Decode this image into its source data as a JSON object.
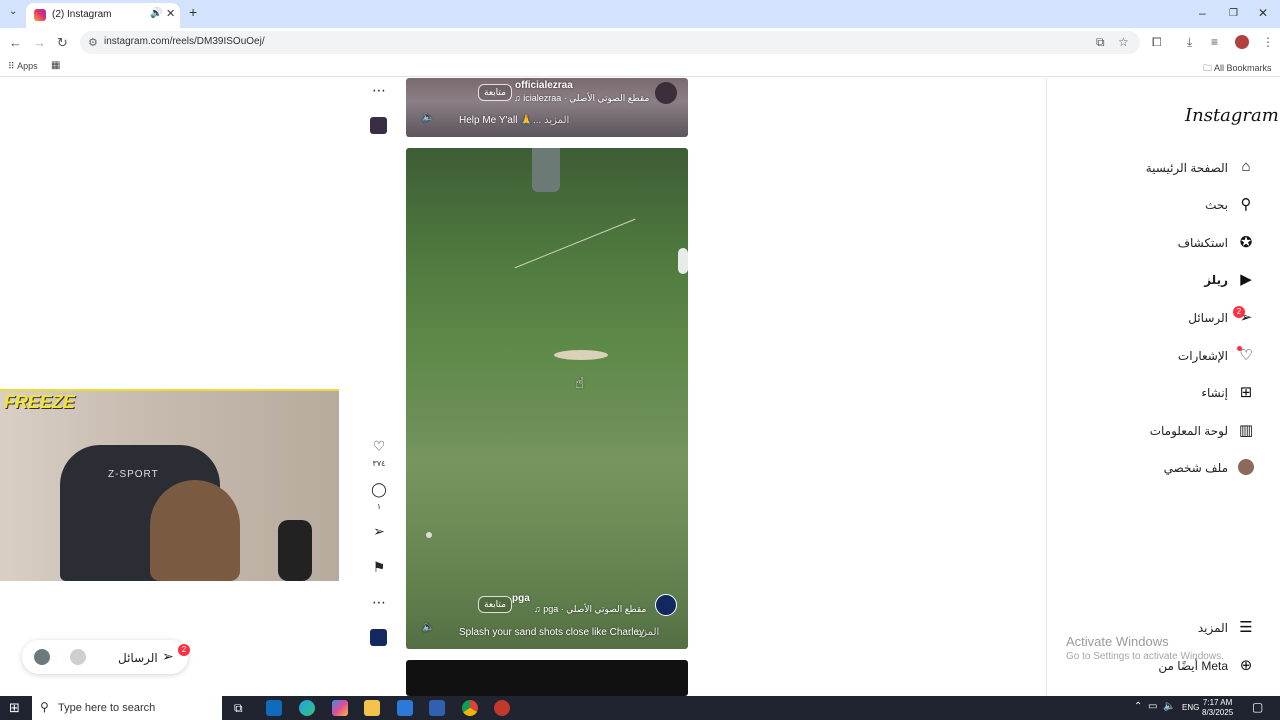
{
  "browser": {
    "tab_title": "(2) Instagram",
    "url": "instagram.com/reels/DM39ISOuOej/",
    "bookmarks": {
      "apps_label": "Apps",
      "all_bookmarks_label": "All Bookmarks"
    }
  },
  "reels": [
    {
      "username": "officialezraa",
      "follow_label": "متابعة",
      "audio": "icialezraa · مقطع الصوتي الأصلي",
      "caption": "Help Me Y'all 🙏",
      "more_label": "... المزيد"
    },
    {
      "username": "pga",
      "follow_label": "متابعة",
      "audio": "pga · مقطع الصوتي الأصلي",
      "caption": "Splash your sand shots close like Charley",
      "more_label": "... المزيد",
      "likes": "٣٧٤",
      "comments": "١"
    }
  ],
  "sidebar": {
    "logo": "Instagram",
    "items": [
      {
        "label": "الصفحة الرئيسية",
        "icon": "home-icon"
      },
      {
        "label": "بحث",
        "icon": "search-icon"
      },
      {
        "label": "استكشاف",
        "icon": "compass-icon"
      },
      {
        "label": "ريلز",
        "icon": "reels-icon"
      },
      {
        "label": "الرسائل",
        "icon": "messenger-icon",
        "badge": "2"
      },
      {
        "label": "الإشعارات",
        "icon": "heart-icon"
      },
      {
        "label": "إنشاء",
        "icon": "plus-icon"
      },
      {
        "label": "لوحة المعلومات",
        "icon": "dashboard-icon"
      },
      {
        "label": "ملف شخصي",
        "icon": "avatar-icon"
      }
    ],
    "more_label": "المزيد",
    "meta_label": "أيضًا من Meta"
  },
  "stream_overlay": {
    "brand": "FREEZE",
    "chair_text": "Z-SPORT"
  },
  "messages_pill": {
    "label": "الرسائل",
    "badge": "2"
  },
  "watermark": {
    "line1": "Activate Windows",
    "line2": "Go to Settings to activate Windows."
  },
  "taskbar": {
    "search_placeholder": "Type here to search",
    "lang": "ENG",
    "time": "7:17 AM",
    "date": "8/3/2025"
  }
}
